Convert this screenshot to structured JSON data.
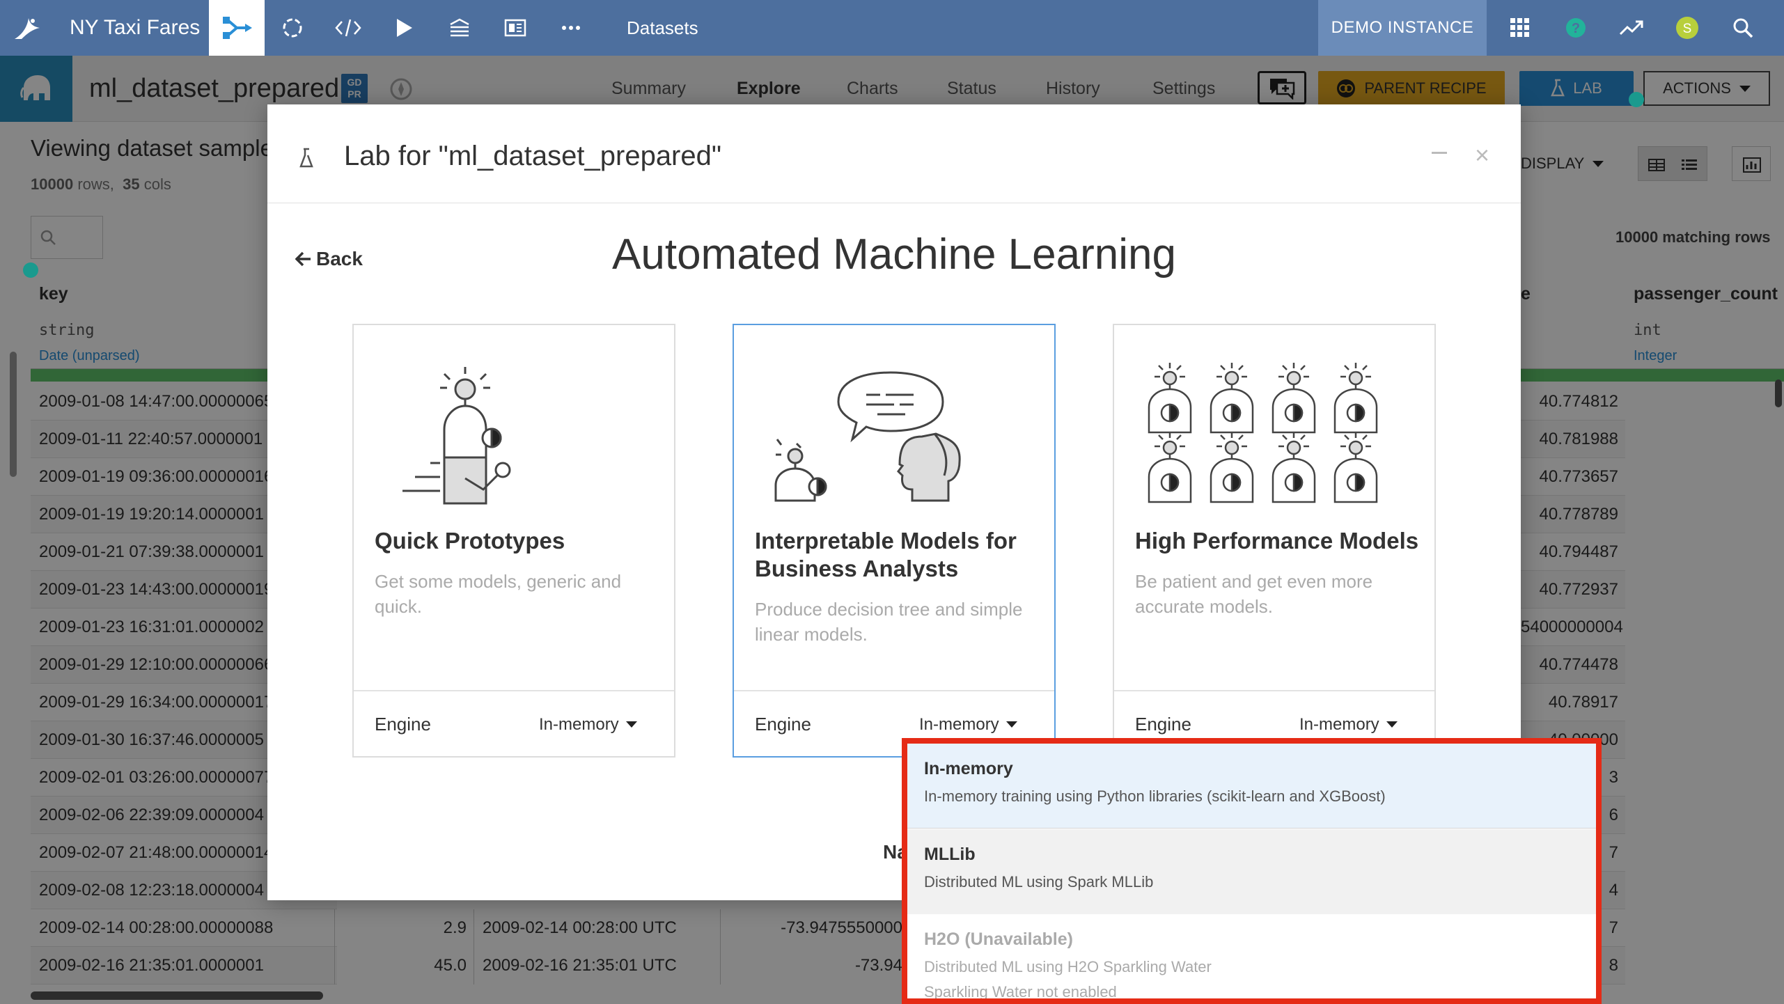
{
  "topbar": {
    "project_name": "NY Taxi Fares",
    "datasets_label": "Datasets",
    "instance_label": "DEMO INSTANCE",
    "user_initial": "S",
    "colors": {
      "bar": "#4d6f9e",
      "instance": "#6b8cb9",
      "avatar": "#b8cf3c",
      "help": "#22b39a"
    }
  },
  "dataset_header": {
    "name": "ml_dataset_prepared",
    "gdpr_top": "GD",
    "gdpr_bottom": "PR",
    "tabs": [
      "Summary",
      "Explore",
      "Charts",
      "Status",
      "History",
      "Settings"
    ],
    "active_tab": "Explore",
    "parent_recipe_label": "PARENT RECIPE",
    "lab_label": "LAB",
    "actions_label": "ACTIONS"
  },
  "dataset_view": {
    "title": "Viewing dataset sample",
    "rows_count": "10000",
    "rows_label": "rows,",
    "cols_count": "35",
    "cols_label": "cols",
    "display_label": "DISPLAY",
    "matching_rows": "10000 matching rows",
    "columns": [
      {
        "name": "key",
        "storage": "string",
        "meaning": "Date (unparsed)"
      },
      {
        "name": "e",
        "storage": "",
        "meaning": ""
      },
      {
        "name": "passenger_count",
        "storage": "int",
        "meaning": "Integer"
      }
    ],
    "key_values": [
      "2009-01-08 14:47:00.00000065",
      "2009-01-11 22:40:57.0000001",
      "2009-01-19 09:36:00.00000016",
      "2009-01-19 19:20:14.0000001",
      "2009-01-21 07:39:38.0000001",
      "2009-01-23 14:43:00.00000019",
      "2009-01-23 16:31:01.0000002",
      "2009-01-29 12:10:00.00000066",
      "2009-01-29 16:34:00.00000017",
      "2009-01-30 16:37:46.0000005",
      "2009-02-01 03:26:00.00000077",
      "2009-02-06 22:39:09.0000004",
      "2009-02-07 21:48:00.00000014",
      "2009-02-08 12:23:18.0000004",
      "2009-02-14 00:28:00.00000088",
      "2009-02-16 21:35:01.0000001"
    ],
    "lat_values": [
      "40.774812",
      "40.781988",
      "40.773657",
      "40.778789",
      "40.794487",
      "40.772937",
      "54000000004",
      "40.774478",
      "40.78917",
      "40.00000",
      "3",
      "6",
      "7",
      "4",
      "7",
      "8"
    ],
    "bottom_rows": [
      {
        "fare": "2.9",
        "pickup": "2009-02-14 00:28:00 UTC",
        "lon": "-73.9475550000"
      },
      {
        "fare": "45.0",
        "pickup": "2009-02-16 21:35:01 UTC",
        "lon": "-73.94"
      }
    ]
  },
  "modal": {
    "title": "Lab for \"ml_dataset_prepared\"",
    "back_label": "Back",
    "heading": "Automated Machine Learning",
    "partial_text": "Na",
    "cards": [
      {
        "title": "Quick Prototypes",
        "description": "Get some models, generic and quick.",
        "engine_label": "Engine",
        "engine_value": "In-memory"
      },
      {
        "title": "Interpretable Models for Business Analysts",
        "description": "Produce decision tree and simple linear models.",
        "engine_label": "Engine",
        "engine_value": "In-memory"
      },
      {
        "title": "High Performance Models",
        "description": "Be patient and get even more accurate models.",
        "engine_label": "Engine",
        "engine_value": "In-memory"
      }
    ]
  },
  "engine_dropdown": {
    "options": [
      {
        "name": "In-memory",
        "description": "In-memory training using Python libraries (scikit-learn and XGBoost)",
        "state": "highlighted"
      },
      {
        "name": "MLLib",
        "description": "Distributed ML using Spark MLLib",
        "state": "normal"
      },
      {
        "name": "H2O (Unavailable)",
        "description": "Distributed ML using H2O Sparkling Water",
        "state": "disabled"
      }
    ],
    "overflow_text": "Sparkling Water not enabled",
    "highlight_color": "#e52b16"
  }
}
